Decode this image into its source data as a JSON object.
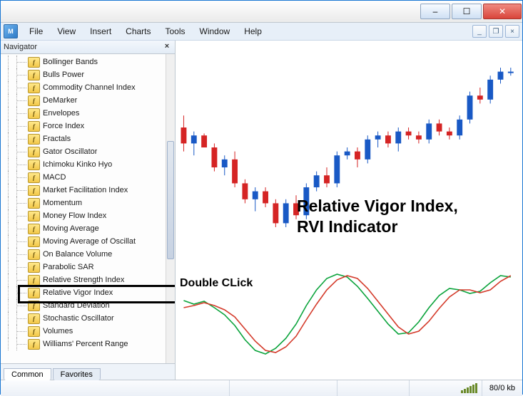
{
  "titlebar": {
    "minimize_glyph": "–",
    "maximize_glyph": "☐",
    "close_glyph": "✕"
  },
  "menubar": {
    "app_icon_text": "M",
    "items": [
      "File",
      "View",
      "Insert",
      "Charts",
      "Tools",
      "Window",
      "Help"
    ],
    "sys_min": "_",
    "sys_restore": "❐",
    "sys_close": "×"
  },
  "navigator": {
    "title": "Navigator",
    "close_glyph": "×",
    "indicators": [
      "Bollinger Bands",
      "Bulls Power",
      "Commodity Channel Index",
      "DeMarker",
      "Envelopes",
      "Force Index",
      "Fractals",
      "Gator Oscillator",
      "Ichimoku Kinko Hyo",
      "MACD",
      "Market Facilitation Index",
      "Momentum",
      "Money Flow Index",
      "Moving Average",
      "Moving Average of Oscillat",
      "On Balance Volume",
      "Parabolic SAR",
      "Relative Strength Index",
      "Relative Vigor Index",
      "Standard Deviation",
      "Stochastic Oscillator",
      "Volumes",
      "Williams' Percent Range"
    ],
    "highlighted_index": 18,
    "fx_glyph": "f",
    "tabs": {
      "common": "Common",
      "favorites": "Favorites"
    }
  },
  "chart_annotations": {
    "title_line1": "Relative Vigor Index,",
    "title_line2": "RVI Indicator",
    "double_click": "Double CLick"
  },
  "status": {
    "kb": "80/0 kb"
  },
  "chart_data": {
    "type": "candlestick+line",
    "upper": {
      "type": "candlestick",
      "colors": {
        "up": "#1959c5",
        "down": "#d52424"
      },
      "note": "approximate OHLC shape, no axis labels visible",
      "candles": [
        {
          "o": 60,
          "h": 66,
          "l": 48,
          "c": 52,
          "dir": "down"
        },
        {
          "o": 52,
          "h": 58,
          "l": 46,
          "c": 56,
          "dir": "up"
        },
        {
          "o": 56,
          "h": 57,
          "l": 50,
          "c": 50,
          "dir": "down"
        },
        {
          "o": 50,
          "h": 52,
          "l": 38,
          "c": 40,
          "dir": "down"
        },
        {
          "o": 40,
          "h": 46,
          "l": 36,
          "c": 44,
          "dir": "up"
        },
        {
          "o": 44,
          "h": 48,
          "l": 30,
          "c": 32,
          "dir": "down"
        },
        {
          "o": 32,
          "h": 34,
          "l": 22,
          "c": 24,
          "dir": "down"
        },
        {
          "o": 24,
          "h": 30,
          "l": 18,
          "c": 28,
          "dir": "up"
        },
        {
          "o": 28,
          "h": 30,
          "l": 20,
          "c": 22,
          "dir": "down"
        },
        {
          "o": 22,
          "h": 24,
          "l": 10,
          "c": 12,
          "dir": "down"
        },
        {
          "o": 12,
          "h": 24,
          "l": 10,
          "c": 22,
          "dir": "up"
        },
        {
          "o": 22,
          "h": 26,
          "l": 14,
          "c": 16,
          "dir": "down"
        },
        {
          "o": 16,
          "h": 32,
          "l": 14,
          "c": 30,
          "dir": "up"
        },
        {
          "o": 30,
          "h": 38,
          "l": 28,
          "c": 36,
          "dir": "up"
        },
        {
          "o": 36,
          "h": 40,
          "l": 30,
          "c": 32,
          "dir": "down"
        },
        {
          "o": 32,
          "h": 48,
          "l": 30,
          "c": 46,
          "dir": "up"
        },
        {
          "o": 46,
          "h": 50,
          "l": 44,
          "c": 48,
          "dir": "up"
        },
        {
          "o": 48,
          "h": 50,
          "l": 40,
          "c": 44,
          "dir": "down"
        },
        {
          "o": 44,
          "h": 56,
          "l": 42,
          "c": 54,
          "dir": "up"
        },
        {
          "o": 54,
          "h": 58,
          "l": 50,
          "c": 56,
          "dir": "up"
        },
        {
          "o": 56,
          "h": 58,
          "l": 50,
          "c": 52,
          "dir": "down"
        },
        {
          "o": 52,
          "h": 60,
          "l": 48,
          "c": 58,
          "dir": "up"
        },
        {
          "o": 58,
          "h": 60,
          "l": 54,
          "c": 56,
          "dir": "down"
        },
        {
          "o": 56,
          "h": 58,
          "l": 52,
          "c": 54,
          "dir": "down"
        },
        {
          "o": 54,
          "h": 64,
          "l": 52,
          "c": 62,
          "dir": "up"
        },
        {
          "o": 62,
          "h": 64,
          "l": 56,
          "c": 58,
          "dir": "down"
        },
        {
          "o": 58,
          "h": 60,
          "l": 54,
          "c": 56,
          "dir": "down"
        },
        {
          "o": 56,
          "h": 66,
          "l": 54,
          "c": 64,
          "dir": "up"
        },
        {
          "o": 64,
          "h": 78,
          "l": 62,
          "c": 76,
          "dir": "up"
        },
        {
          "o": 76,
          "h": 80,
          "l": 72,
          "c": 74,
          "dir": "down"
        },
        {
          "o": 74,
          "h": 86,
          "l": 72,
          "c": 84,
          "dir": "up"
        },
        {
          "o": 84,
          "h": 90,
          "l": 82,
          "c": 88,
          "dir": "up"
        },
        {
          "o": 88,
          "h": 90,
          "l": 86,
          "c": 88,
          "dir": "up"
        }
      ]
    },
    "lower": {
      "type": "line",
      "series": [
        {
          "name": "RVI",
          "color": "#0aa33b",
          "values": [
            15,
            10,
            14,
            5,
            -5,
            -20,
            -40,
            -55,
            -60,
            -52,
            -38,
            -18,
            8,
            30,
            46,
            52,
            48,
            35,
            18,
            0,
            -18,
            -32,
            -30,
            -15,
            5,
            22,
            32,
            30,
            25,
            28,
            40,
            50,
            48
          ]
        },
        {
          "name": "Signal",
          "color": "#d43a2a",
          "values": [
            5,
            8,
            12,
            8,
            2,
            -8,
            -25,
            -42,
            -55,
            -58,
            -50,
            -35,
            -12,
            10,
            30,
            44,
            50,
            46,
            32,
            14,
            -4,
            -22,
            -32,
            -28,
            -14,
            4,
            20,
            30,
            30,
            26,
            30,
            42,
            50
          ]
        }
      ],
      "range": [
        -70,
        60
      ]
    }
  }
}
